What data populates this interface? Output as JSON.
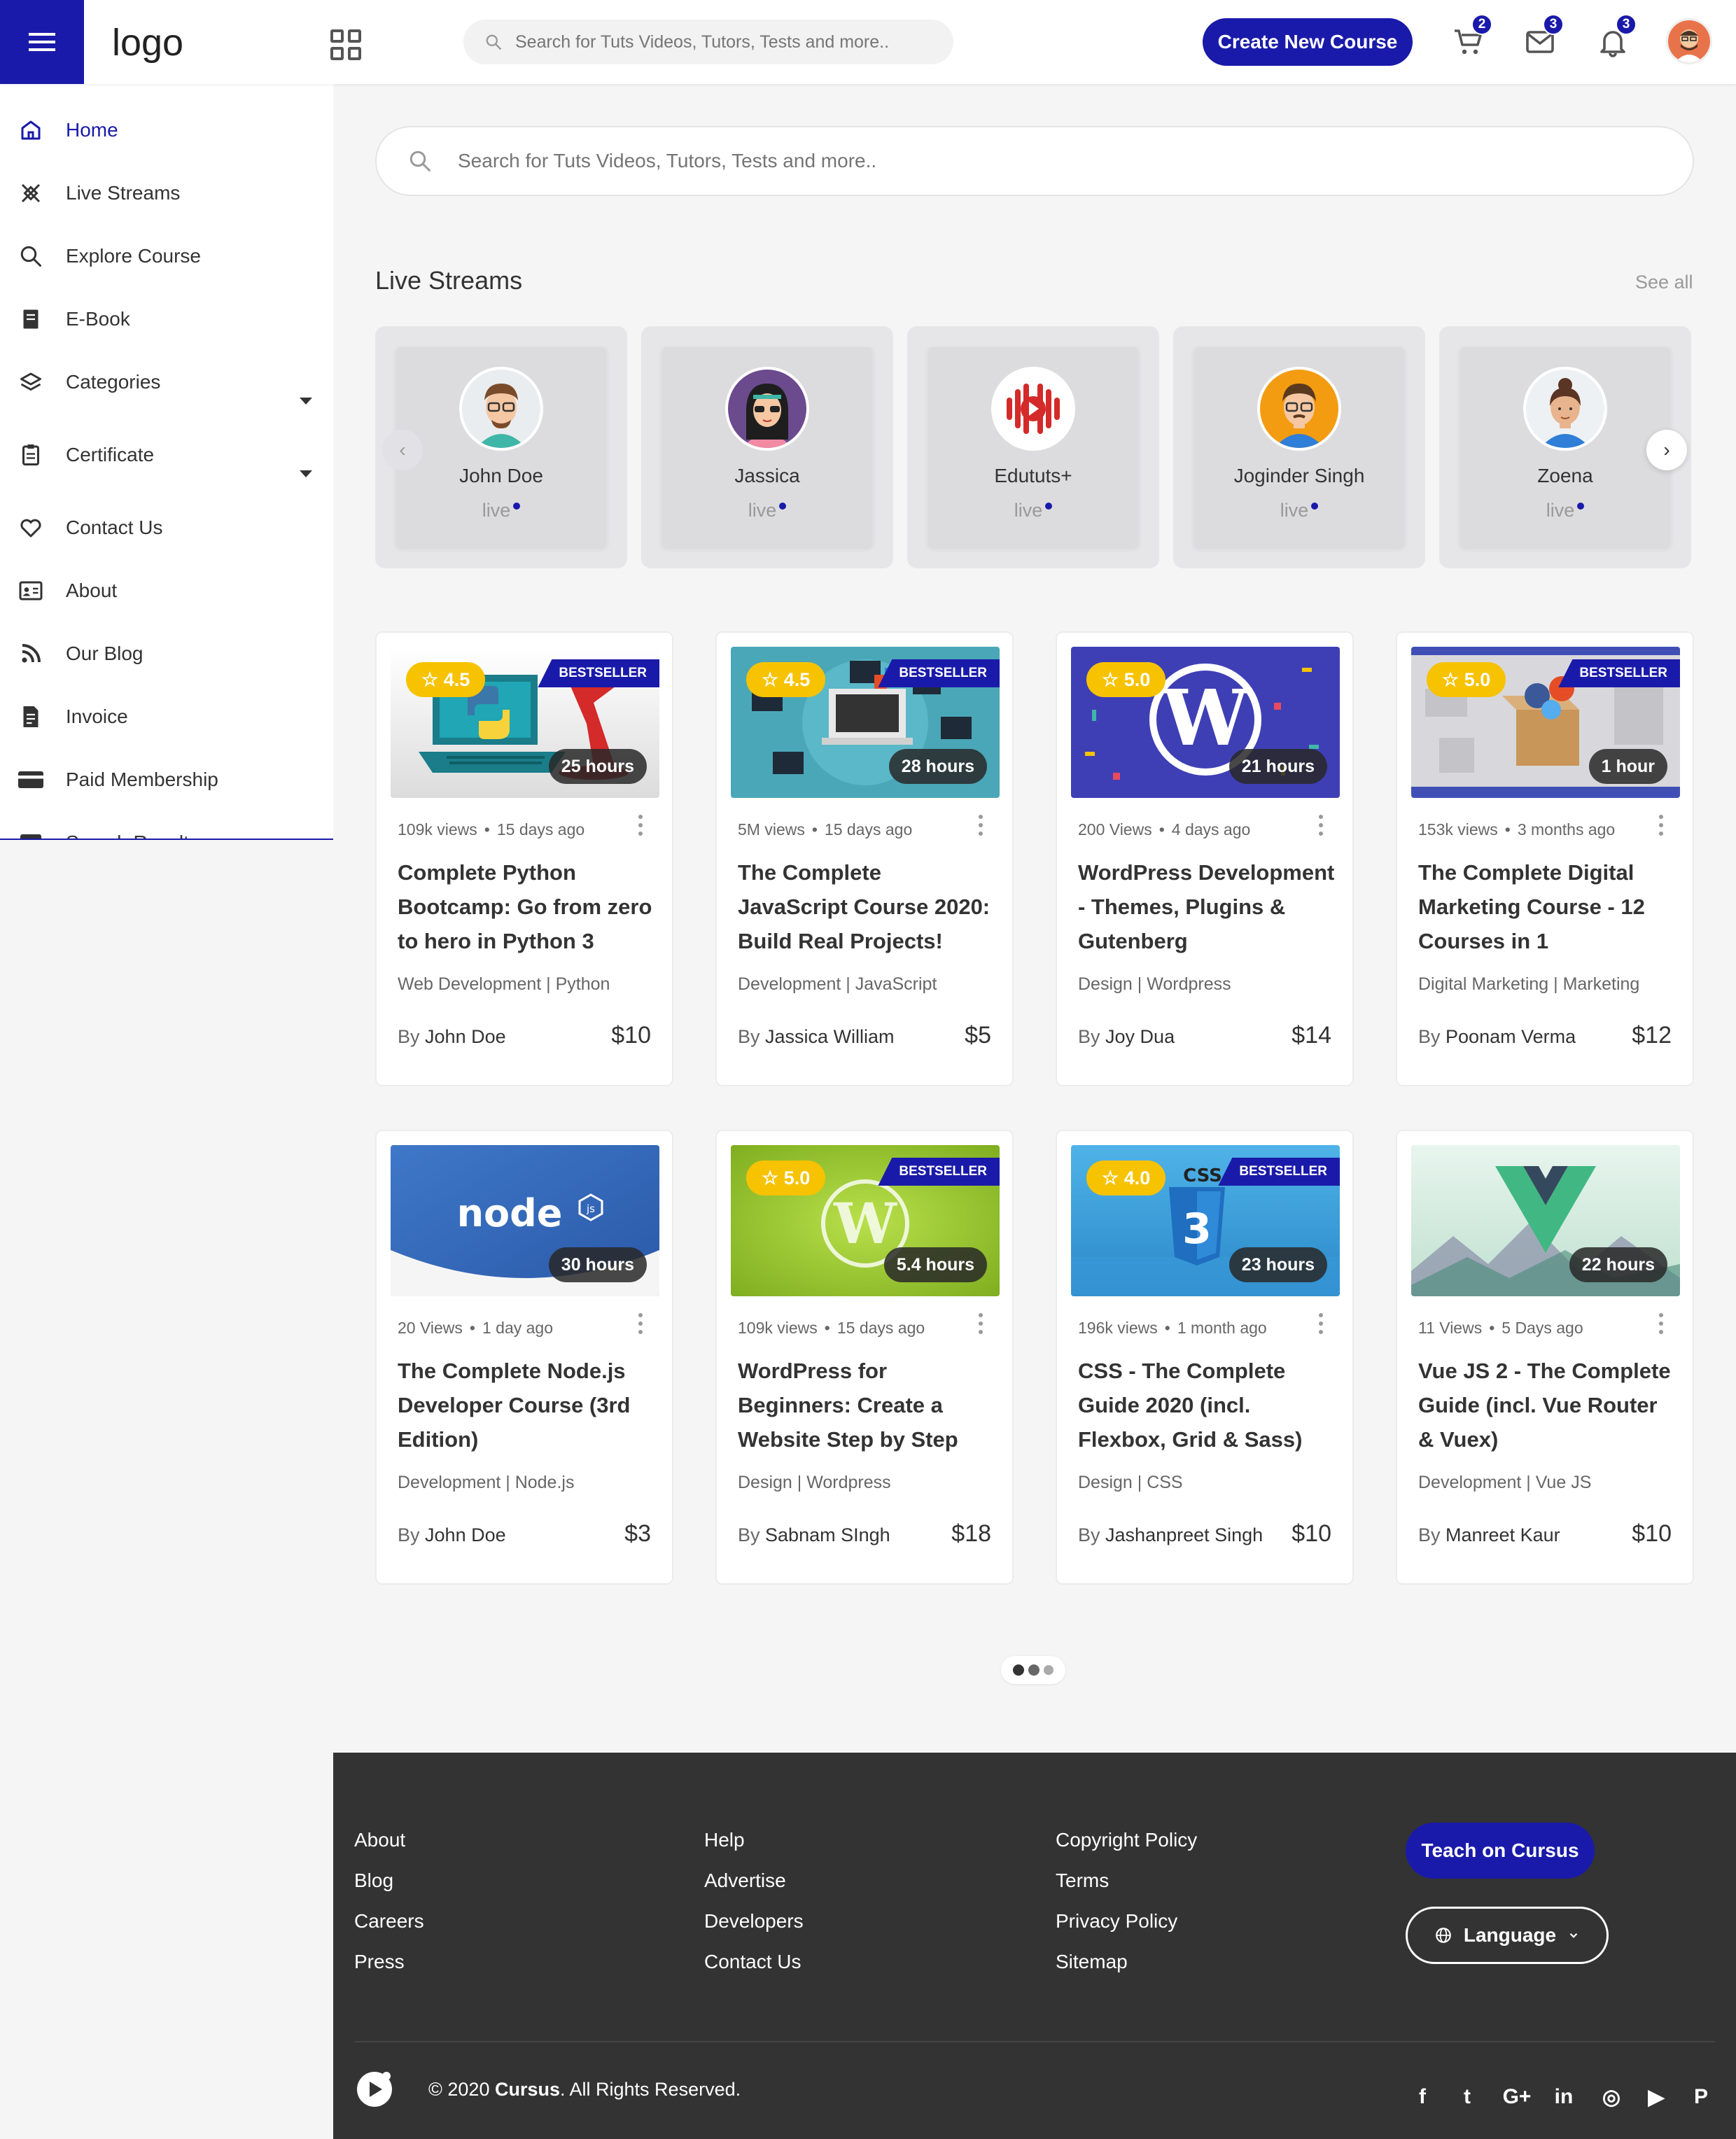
{
  "header": {
    "logo": "logo",
    "search_placeholder": "Search for Tuts Videos, Tutors, Tests and more..",
    "create_button": "Create New Course",
    "cart_count": "2",
    "mail_count": "3",
    "notification_count": "3"
  },
  "sidebar": {
    "items": [
      {
        "label": "Home",
        "icon": "home-icon",
        "active": true
      },
      {
        "label": "Live Streams",
        "icon": "satellite-icon"
      },
      {
        "label": "Explore Course",
        "icon": "search-icon"
      },
      {
        "label": "E-Book",
        "icon": "book-icon"
      },
      {
        "label": "Categories",
        "icon": "layers-icon",
        "has_dropdown": true
      },
      {
        "label": "Certificate",
        "icon": "clipboard-icon",
        "has_dropdown": true
      },
      {
        "label": "Contact Us",
        "icon": "heart-icon"
      },
      {
        "label": "About",
        "icon": "id-card-icon"
      },
      {
        "label": "Our Blog",
        "icon": "blog-icon"
      },
      {
        "label": "Invoice",
        "icon": "invoice-icon"
      },
      {
        "label": "Paid Membership",
        "icon": "credit-card-icon"
      },
      {
        "label": "Search Results",
        "icon": "search-results-icon"
      }
    ]
  },
  "main": {
    "search_placeholder": "Search for Tuts Videos, Tutors, Tests and more..",
    "live_title": "Live Streams",
    "see_all": "See all",
    "live_streams": [
      {
        "name": "John Doe",
        "status": "live"
      },
      {
        "name": "Jassica",
        "status": "live"
      },
      {
        "name": "Edututs+",
        "status": "live"
      },
      {
        "name": "Joginder Singh",
        "status": "live"
      },
      {
        "name": "Zoena",
        "status": "live"
      }
    ],
    "courses": [
      {
        "rating": "4.5",
        "bestseller": "BESTSELLER",
        "hours": "25 hours",
        "views": "109k views",
        "ago": "15 days ago",
        "title": "Complete Python Bootcamp: Go from zero to hero in Python 3",
        "category": "Web Development | Python",
        "by": "By",
        "author": "John Doe",
        "price": "$10"
      },
      {
        "rating": "4.5",
        "bestseller": "BESTSELLER",
        "hours": "28 hours",
        "views": "5M views",
        "ago": "15 days ago",
        "title": "The Complete JavaScript Course 2020: Build Real Projects!",
        "category": "Development | JavaScript",
        "by": "By",
        "author": "Jassica William",
        "price": "$5"
      },
      {
        "rating": "5.0",
        "bestseller": "",
        "hours": "21 hours",
        "views": "200 Views",
        "ago": "4 days ago",
        "title": "WordPress Development - Themes, Plugins & Gutenberg",
        "category": "Design | Wordpress",
        "by": "By",
        "author": "Joy Dua",
        "price": "$14"
      },
      {
        "rating": "5.0",
        "bestseller": "BESTSELLER",
        "hours": "1 hour",
        "views": "153k views",
        "ago": "3 months ago",
        "title": "The Complete Digital Marketing Course - 12 Courses in 1",
        "category": "Digital Marketing | Marketing",
        "by": "By",
        "author": "Poonam Verma",
        "price": "$12"
      },
      {
        "rating": "",
        "bestseller": "",
        "hours": "30 hours",
        "views": "20 Views",
        "ago": "1 day ago",
        "title": "The Complete Node.js Developer Course (3rd Edition)",
        "category": "Development | Node.js",
        "by": "By",
        "author": "John Doe",
        "price": "$3"
      },
      {
        "rating": "5.0",
        "bestseller": "BESTSELLER",
        "hours": "5.4 hours",
        "views": "109k views",
        "ago": "15 days ago",
        "title": "WordPress for Beginners: Create a Website Step by Step",
        "category": "Design | Wordpress",
        "by": "By",
        "author": "Sabnam SIngh",
        "price": "$18"
      },
      {
        "rating": "4.0",
        "bestseller": "BESTSELLER",
        "hours": "23 hours",
        "views": "196k views",
        "ago": "1 month ago",
        "title": "CSS - The Complete Guide 2020 (incl. Flexbox, Grid & Sass)",
        "category": "Design | CSS",
        "by": "By",
        "author": "Jashanpreet Singh",
        "price": "$10"
      },
      {
        "rating": "",
        "bestseller": "",
        "hours": "22 hours",
        "views": "11 Views",
        "ago": "5 Days ago",
        "title": "Vue JS 2 - The Complete Guide (incl. Vue Router & Vuex)",
        "category": "Development | Vue JS",
        "by": "By",
        "author": "Manreet Kaur",
        "price": "$10"
      }
    ],
    "thumb_texts": {
      "node": "node",
      "node_js": "js",
      "css": "CSS",
      "css3": "3"
    }
  },
  "footer": {
    "col1": [
      "About",
      "Blog",
      "Careers",
      "Press"
    ],
    "col2": [
      "Help",
      "Advertise",
      "Developers",
      "Contact Us"
    ],
    "col3": [
      "Copyright Policy",
      "Terms",
      "Privacy Policy",
      "Sitemap"
    ],
    "teach_button": "Teach on Cursus",
    "language_button": "Language",
    "copyright_prefix": "© 2020 ",
    "copyright_brand": "Cursus",
    "copyright_suffix": ". All Rights Reserved.",
    "social": [
      {
        "icon": "facebook-icon",
        "glyph": "f"
      },
      {
        "icon": "twitter-icon",
        "glyph": "t"
      },
      {
        "icon": "google-plus-icon",
        "glyph": "G+"
      },
      {
        "icon": "linkedin-icon",
        "glyph": "in"
      },
      {
        "icon": "instagram-icon",
        "glyph": "◎"
      },
      {
        "icon": "youtube-icon",
        "glyph": "▶"
      },
      {
        "icon": "pinterest-icon",
        "glyph": "P"
      }
    ]
  },
  "colors": {
    "accent": "#1a1aaa",
    "rating": "#f7c200",
    "footer": "#333333"
  }
}
